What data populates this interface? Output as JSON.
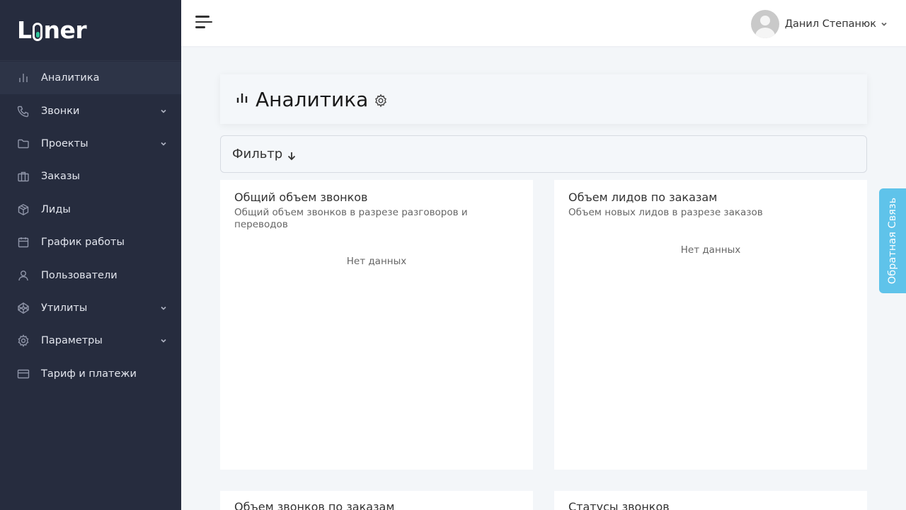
{
  "brand": {
    "logo_text_start": "L",
    "logo_text_end": "ner"
  },
  "sidebar": {
    "items": [
      {
        "label": "Аналитика",
        "icon": "bar-chart-icon",
        "active": true,
        "has_submenu": false
      },
      {
        "label": "Звонки",
        "icon": "phone-icon",
        "active": false,
        "has_submenu": true
      },
      {
        "label": "Проекты",
        "icon": "folder-icon",
        "active": false,
        "has_submenu": true
      },
      {
        "label": "Заказы",
        "icon": "briefcase-icon",
        "active": false,
        "has_submenu": false
      },
      {
        "label": "Лиды",
        "icon": "box-icon",
        "active": false,
        "has_submenu": false
      },
      {
        "label": "График работы",
        "icon": "calendar-icon",
        "active": false,
        "has_submenu": false
      },
      {
        "label": "Пользователи",
        "icon": "user-icon",
        "active": false,
        "has_submenu": false
      },
      {
        "label": "Утилиты",
        "icon": "codepen-icon",
        "active": false,
        "has_submenu": true
      },
      {
        "label": "Параметры",
        "icon": "gear-icon",
        "active": false,
        "has_submenu": true
      },
      {
        "label": "Тариф и платежи",
        "icon": "credit-card-icon",
        "active": false,
        "has_submenu": false
      }
    ]
  },
  "header": {
    "user_name": "Данил Степанюк"
  },
  "page": {
    "title": "Аналитика",
    "filter_label": "Фильтр"
  },
  "cards": [
    {
      "title": "Общий объем звонков",
      "subtitle": "Общий объем звонков в разрезе разговоров и переводов",
      "empty_text": "Нет данных"
    },
    {
      "title": "Объем лидов по заказам",
      "subtitle": "Объем новых лидов в разрезе заказов",
      "empty_text": "Нет данных"
    },
    {
      "title": "Объем звонков по заказам",
      "subtitle": "",
      "empty_text": ""
    },
    {
      "title": "Статусы звонков",
      "subtitle": "",
      "empty_text": ""
    }
  ],
  "feedback_label": "Обратная Связь",
  "colors": {
    "sidebar_bg": "#262c3e",
    "accent_green": "#2fc49a",
    "feedback_bg": "#5fc3ea"
  }
}
